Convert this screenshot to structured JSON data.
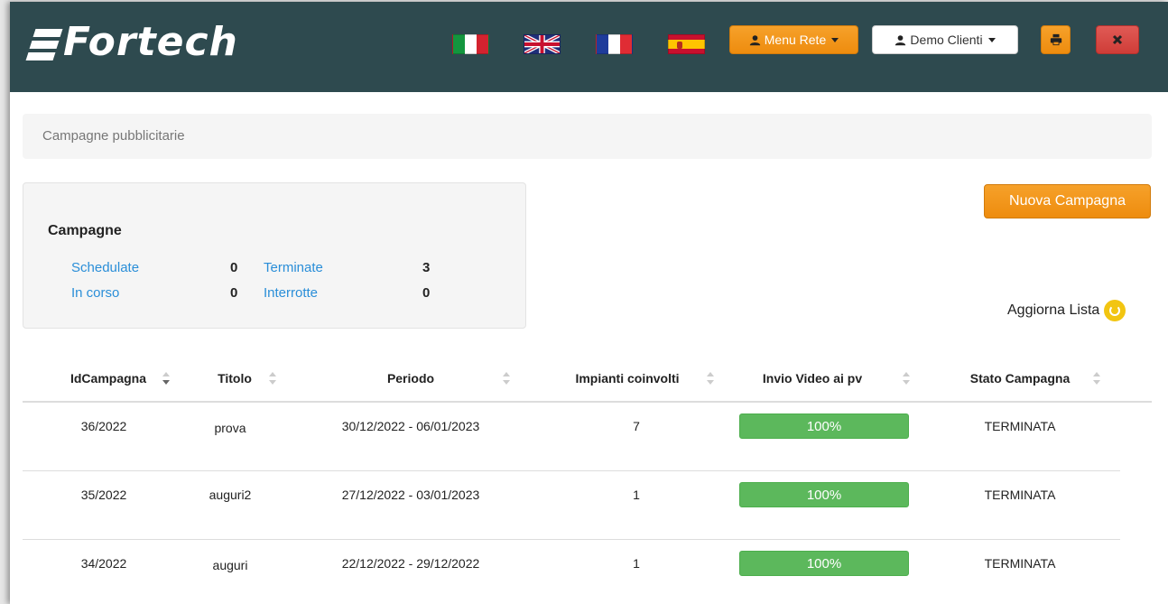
{
  "header": {
    "logo_text": "Fortech",
    "flags": [
      "italian-flag-icon",
      "uk-flag-icon",
      "french-flag-icon",
      "spanish-flag-icon"
    ],
    "menu_rete_label": "Menu Rete",
    "demo_clienti_label": "Demo Clienti",
    "colors": {
      "bar": "#2e4a4f",
      "accent": "#f0931a",
      "danger": "#d9534f"
    }
  },
  "breadcrumb": "Campagne pubblicitarie",
  "summary": {
    "title": "Campagne",
    "schedulate_label": "Schedulate",
    "schedulate_value": "0",
    "in_corso_label": "In corso",
    "in_corso_value": "0",
    "terminate_label": "Terminate",
    "terminate_value": "3",
    "interrotte_label": "Interrotte",
    "interrotte_value": "0"
  },
  "actions": {
    "new_campaign_label": "Nuova Campagna",
    "refresh_label": "Aggiorna Lista"
  },
  "table": {
    "columns": [
      "IdCampagna",
      "Titolo",
      "Periodo",
      "Impianti coinvolti",
      "Invio Video ai pv",
      "Stato Campagna"
    ],
    "rows": [
      {
        "id": "36/2022",
        "titolo": "prova",
        "periodo": "30/12/2022 - 06/01/2023",
        "impianti": "7",
        "invio": "100%",
        "invio_fraction": 1.0,
        "stato": "TERMINATA"
      },
      {
        "id": "35/2022",
        "titolo": "auguri2",
        "periodo": "27/12/2022 - 03/01/2023",
        "impianti": "1",
        "invio": "100%",
        "invio_fraction": 1.0,
        "stato": "TERMINATA"
      },
      {
        "id": "34/2022",
        "titolo": "auguri",
        "periodo": "22/12/2022 - 29/12/2022",
        "impianti": "1",
        "invio": "100%",
        "invio_fraction": 1.0,
        "stato": "TERMINATA"
      }
    ]
  }
}
